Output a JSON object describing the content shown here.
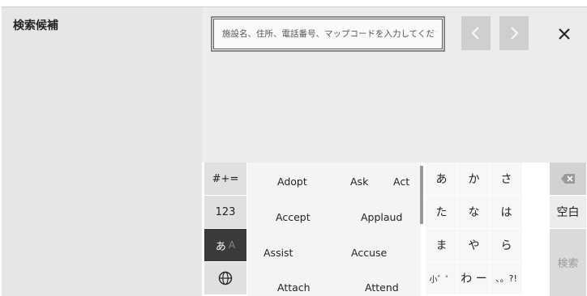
{
  "left_pane": {
    "title": "検索候補"
  },
  "search": {
    "placeholder": "施設名、住所、電話番号、マップコードを入力してください"
  },
  "nav": {
    "prev_icon": "chevron-left-icon",
    "next_icon": "chevron-right-icon",
    "close_icon": "close-icon"
  },
  "keyboard": {
    "modes": {
      "symbols": "#+=",
      "numbers": "123",
      "kana_main": "あ",
      "kana_alt": "A",
      "globe_icon": "globe-icon"
    },
    "candidates": [
      "Adopt",
      "Ask",
      "Act",
      "Accept",
      "Applaud",
      "Assist",
      "Accuse",
      "Attach",
      "Attend"
    ],
    "kana_keys": [
      "あ",
      "か",
      "さ",
      "た",
      "な",
      "は",
      "ま",
      "や",
      "ら",
      "小゛゜",
      "わ ー",
      "、。?!"
    ],
    "space_label": "空白",
    "search_label": "検索",
    "backspace_icon": "backspace-icon"
  },
  "colors": {
    "active_mode_bg": "#3a3a3a",
    "disabled_text": "#9a9a9a"
  }
}
